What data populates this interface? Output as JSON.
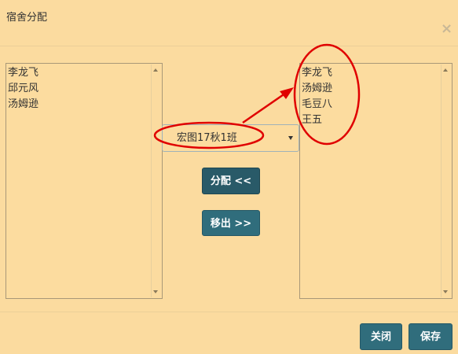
{
  "dialog": {
    "title": "宿舍分配",
    "close_icon": "×"
  },
  "left_list": {
    "items": [
      "李龙飞",
      "邱元风",
      "汤姆逊"
    ]
  },
  "class_select": {
    "value": "宏图17秋1班"
  },
  "buttons": {
    "assign_label": "分配 <<",
    "remove_label": "移出 >>",
    "close_label": "关闭",
    "save_label": "保存"
  },
  "right_list": {
    "items": [
      "李龙飞",
      "汤姆逊",
      "毛豆八",
      "王五"
    ]
  },
  "annotations": {
    "color": "#e00000"
  }
}
